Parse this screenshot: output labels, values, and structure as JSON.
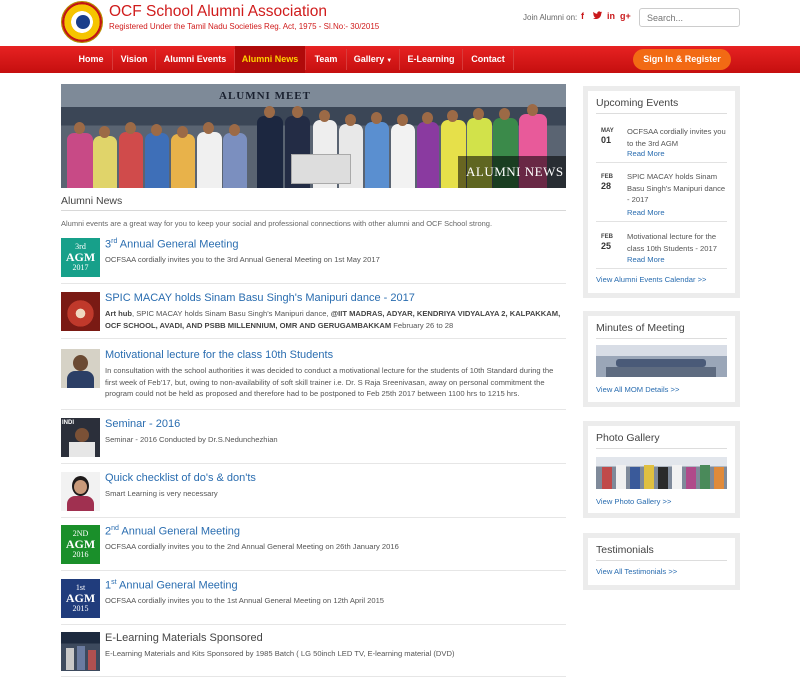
{
  "header": {
    "title": "OCF School Alumni Association",
    "subtitle": "Registered Under the Tamil Nadu Societies Reg. Act, 1975 - Sl.No:- 30/2015",
    "join_label": "Join Alumni on:",
    "social": [
      "f",
      "★",
      "in",
      "g+"
    ],
    "search_placeholder": "Search..."
  },
  "nav": {
    "items": [
      "Home",
      "Vision",
      "Alumni Events",
      "Alumni News",
      "Team",
      "Gallery",
      "E-Learning",
      "Contact"
    ],
    "active": "Alumni News",
    "signin": "Sign In & Register"
  },
  "banner": {
    "sign": "ALUMNI MEET",
    "caption": "ALUMNI NEWS"
  },
  "main": {
    "section_title": "Alumni News",
    "intro": "Alumni events are a great way for you to keep your social and professional connections with other alumni and OCF School strong.",
    "news": [
      {
        "title_sup": "rd",
        "title_pre": "3",
        "title_rest": " Annual General Meeting",
        "desc": "OCFSAA cordially invites you to the 3rd Annual General Meeting on 1st May 2017",
        "thumb": {
          "l1": "3rd",
          "l2": "AGM",
          "l3": "2017"
        }
      },
      {
        "title": "SPIC MACAY holds Sinam Basu Singh's Manipuri dance - 2017",
        "desc_bold1": "Art hub",
        "desc_mid": ", SPIC MACAY holds Sinam Basu Singh's Manipuri dance, ",
        "desc_bold2": "@IIT MADRAS, ADYAR, KENDRIYA VIDYALAYA 2, KALPAKKAM, OCF SCHOOL, AVADI, AND PSBB MILLENNIUM, OMR AND GERUGAMBAKKAM",
        "desc_end": " February 26 to 28"
      },
      {
        "title": "Motivational lecture for the class 10th Students",
        "desc": "In consultation with the school authorities it was decided to conduct a motivational lecture for the students of 10th Standard during the first week of Feb'17, but, owing to non-availability of soft skill trainer i.e. Dr. S Raja Sreenivasan, away on personal commitment the program could not be held as proposed and therefore had to be postponed to Feb 25th 2017 between 1100 hrs to 1215 hrs."
      },
      {
        "title": "Seminar - 2016",
        "desc": "Seminar - 2016 Conducted by Dr.S.Nedunchezhian",
        "thumb_text": "INDI"
      },
      {
        "title": "Quick checklist of do's & don'ts",
        "desc": "Smart Learning is very necessary"
      },
      {
        "title_pre": "2",
        "title_sup": "nd",
        "title_rest": " Annual General Meeting",
        "desc": "OCFSAA cordially invites you to the 2nd Annual General Meeting on 26th January 2016",
        "thumb": {
          "l1": "2ND",
          "l2": "AGM",
          "l3": "2016"
        }
      },
      {
        "title_pre": "1",
        "title_sup": "st",
        "title_rest": " Annual General Meeting",
        "desc": "OCFSAA cordially invites you to the 1st Annual General Meeting on 12th April 2015",
        "thumb": {
          "l1": "1st",
          "l2": "AGM",
          "l3": "2015"
        }
      },
      {
        "title": "E-Learning Materials Sponsored",
        "desc": "E-Learning Materials and Kits Sponsored by 1985 Batch ( LG 50inch LED TV, E-learning material (DVD)"
      }
    ]
  },
  "sidebar": {
    "events": {
      "title": "Upcoming Events",
      "items": [
        {
          "month": "MAY",
          "day": "01",
          "text": "OCFSAA cordially invites you to the 3rd AGM",
          "more": "Read More"
        },
        {
          "month": "FEB",
          "day": "28",
          "text": "SPIC MACAY holds Sinam Basu Singh's Manipuri dance - 2017",
          "more": "Read More"
        },
        {
          "month": "FEB",
          "day": "25",
          "text": "Motivational lecture for the class 10th Students - 2017",
          "more": "Read More"
        }
      ],
      "link": "View Alumni Events Calendar >>"
    },
    "mom": {
      "title": "Minutes of Meeting",
      "link": "View All MOM Details >>"
    },
    "gallery": {
      "title": "Photo Gallery",
      "link": "View Photo Gallery >>"
    },
    "testimonials": {
      "title": "Testimonials",
      "link": "View All Testimonials >>"
    }
  },
  "colors": {
    "brand_red": "#d01c1c",
    "nav_active_text": "#ffd200",
    "signin_orange": "#f26a14",
    "link_blue": "#2a6db0",
    "agm_teal": "#17a08a",
    "agm_green": "#1a8f2a",
    "agm_navy": "#203c7c"
  }
}
